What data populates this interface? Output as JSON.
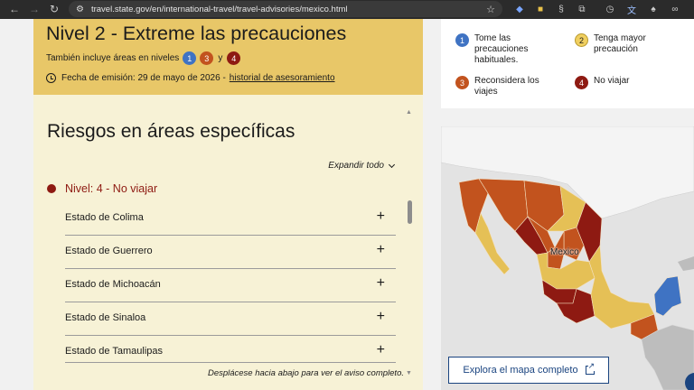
{
  "browser": {
    "url": "travel.state.gov/en/international-travel/travel-advisories/mexico.html"
  },
  "advisory": {
    "title": "Nivel 2 - Extreme las precauciones",
    "also_includes": "También incluye áreas en niveles",
    "also_levels": [
      "1",
      "3",
      "4"
    ],
    "and_word": "y",
    "issued_prefix": "Fecha de emisión: 29 de mayo de 2026 -",
    "history_link": "historial de asesoramiento"
  },
  "risks": {
    "title": "Riesgos en áreas específicas",
    "expand_all": "Expandir todo",
    "level_heading": "Nivel: 4 - No viajar",
    "states": [
      "Estado de Colima",
      "Estado de Guerrero",
      "Estado de Michoacán",
      "Estado de Sinaloa",
      "Estado de Tamaulipas"
    ],
    "scroll_hint": "Desplácese hacia abajo para ver el aviso completo."
  },
  "legend": {
    "items": [
      {
        "num": "1",
        "label": "Tome las precauciones habituales."
      },
      {
        "num": "2",
        "label": "Tenga mayor precaución"
      },
      {
        "num": "3",
        "label": "Reconsidera los viajes"
      },
      {
        "num": "4",
        "label": "No viajar"
      }
    ]
  },
  "map": {
    "label": "Mexico",
    "button": "Explora el mapa completo"
  },
  "colors": {
    "level1": "#3f73c3",
    "level2": "#f0cf60",
    "level3": "#c2531e",
    "level4": "#8e1a12",
    "header_band": "#e8c768",
    "risk_panel": "#f7f2d6",
    "link_blue": "#1a4480"
  }
}
